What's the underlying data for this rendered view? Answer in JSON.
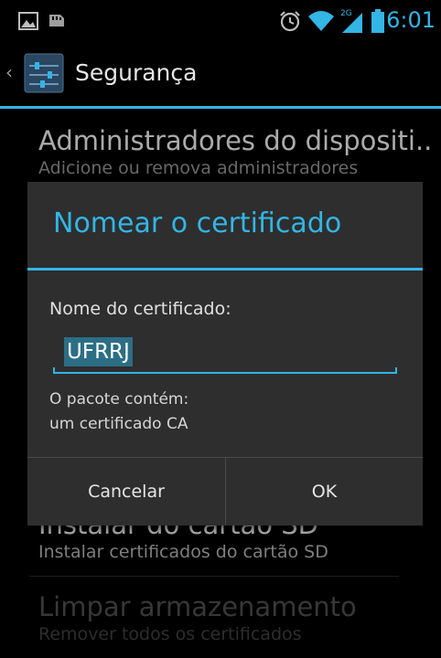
{
  "status_bar": {
    "time": "16:01",
    "network_label": "2G",
    "left_icons": [
      "image-notification-icon",
      "sd-card-icon"
    ],
    "right_icons": [
      "alarm-icon",
      "wifi-icon",
      "signal-icon",
      "battery-icon"
    ]
  },
  "action_bar": {
    "title": "Segurança",
    "app_icon": "settings-icon"
  },
  "background_list": {
    "items": [
      {
        "title": "Administradores do dispositi..",
        "summary": "Adicione ou remova administradores"
      },
      {
        "title": "Instalar do cartão SD",
        "summary": "Instalar certificados do cartão SD"
      },
      {
        "title": "Limpar armazenamento",
        "summary": "Remover todos os certificados"
      }
    ]
  },
  "dialog": {
    "title": "Nomear o certificado",
    "field_label": "Nome do certificado:",
    "field_value": "UFRRJ",
    "info_line1": "O pacote contém:",
    "info_line2": "um certificado CA",
    "cancel_label": "Cancelar",
    "ok_label": "OK"
  },
  "colors": {
    "accent": "#33b5e5",
    "dialog_bg": "#2e2e2e",
    "text_selection": "#2c6e86"
  }
}
